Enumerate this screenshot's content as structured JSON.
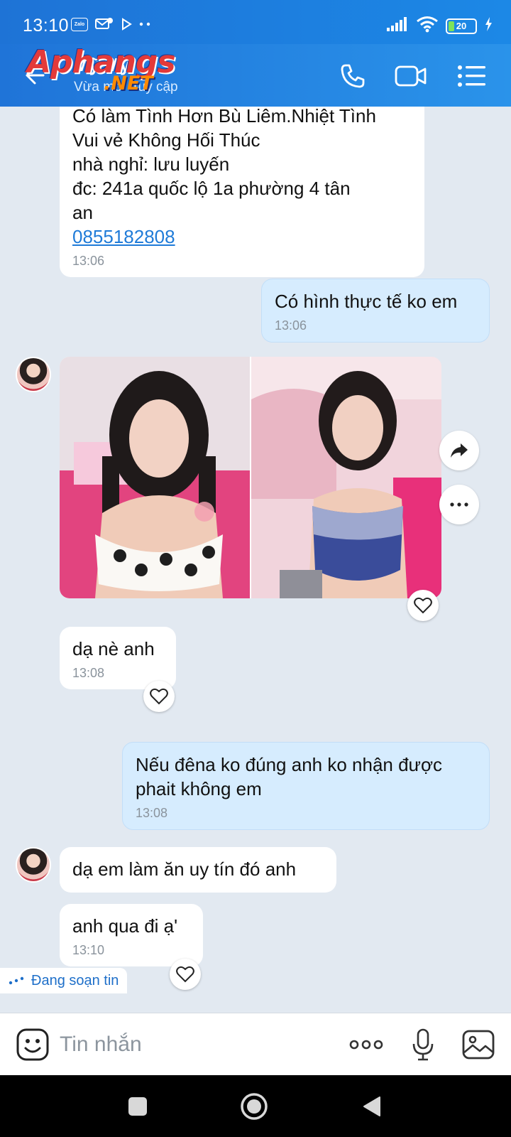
{
  "status_bar": {
    "time": "13:10",
    "battery": "20",
    "zalo_badge": "Zalo"
  },
  "header": {
    "contact_name": "Mỹ Mỹ",
    "contact_status": "Vừa mới truy cập",
    "watermark_main": "Aphangs",
    "watermark_sub": ".NET"
  },
  "messages": [
    {
      "side": "in",
      "lines": [
        "Có làm Tình Hơn Bù Liêm.Nhiệt Tình",
        "Vui vẻ Không Hối Thúc",
        "nhà nghỉ: lưu luyến",
        "đc: 241a quốc lộ 1a phường 4 tân",
        "an"
      ],
      "phone": "0855182808",
      "time": "13:06"
    },
    {
      "side": "out",
      "text": "Có hình thực tế ko em",
      "time": "13:06"
    },
    {
      "side": "in",
      "type": "photos"
    },
    {
      "side": "in",
      "text": "dạ nè anh",
      "time": "13:08"
    },
    {
      "side": "out",
      "lines": [
        "Nếu đêna ko đúng anh ko nhận được",
        "phait không em"
      ],
      "time": "13:08"
    },
    {
      "side": "in",
      "text": "dạ em làm ăn uy tín đó anh"
    },
    {
      "side": "in",
      "text": "anh qua đi ạ'",
      "time": "13:10"
    }
  ],
  "typing_indicator": "Đang soạn tin",
  "composer": {
    "placeholder": "Tin nhắn"
  },
  "icons": {
    "back": "back-arrow-icon",
    "call": "phone-icon",
    "video": "video-camera-icon",
    "menu": "menu-list-icon",
    "share": "share-icon",
    "more": "more-icon",
    "like": "heart-icon",
    "emoji": "emoji-icon",
    "mic": "microphone-icon",
    "gallery": "image-icon"
  },
  "colors": {
    "header": "#1f7ce0",
    "outgoing_bubble": "#d6ecfe",
    "incoming_bubble": "#ffffff",
    "background": "#e2e9f1",
    "link": "#1f7bd8"
  }
}
